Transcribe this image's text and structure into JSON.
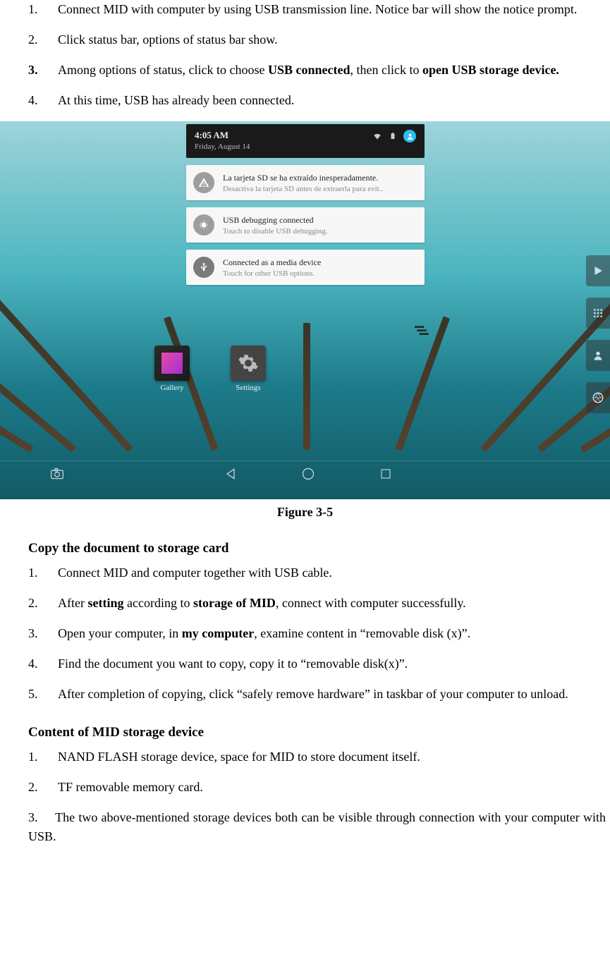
{
  "steps_usb": [
    {
      "n": "1.",
      "text": "Connect MID with computer by using USB transmission line. Notice bar will show the notice prompt.",
      "bold_n": false
    },
    {
      "n": "2.",
      "text": "Click status bar, options of status bar show.",
      "bold_n": false
    },
    {
      "n": "3.",
      "pre": "Among options of status, click to choose ",
      "b1": "USB connected",
      "mid": ", then click to ",
      "b2": "open USB storage device.",
      "bold_n": true
    },
    {
      "n": "4.",
      "text": "At this time, USB has already been connected.",
      "bold_n": false
    }
  ],
  "figure_caption": "Figure 3-5",
  "screenshot": {
    "time": "4:05 AM",
    "date": "Friday, August 14",
    "notif1": {
      "title": "La tarjeta SD se ha extraído inesperadamente.",
      "sub": "Desactiva la tarjeta SD antes de extraerla para evit.."
    },
    "notif2": {
      "title": "USB debugging connected",
      "sub": "Touch to disable USB debugging."
    },
    "notif3": {
      "title": "Connected as a media device",
      "sub": "Touch for other USB options."
    },
    "app1": "Gallery",
    "app2": "Settings"
  },
  "section2_title": "Copy the document to storage card",
  "steps_copy": [
    {
      "n": "1.",
      "text": "Connect MID and computer together with USB cable."
    },
    {
      "n": "2.",
      "pre": "After ",
      "b1": "setting",
      "mid": " according to ",
      "b2": "storage of MID",
      "post": ", connect with computer successfully."
    },
    {
      "n": "3.",
      "pre": "Open your computer, in ",
      "b1": "my computer",
      "post": ", examine content in “removable disk (x)”."
    },
    {
      "n": "4.",
      "text": "Find the document you want to copy, copy it to “removable disk(x)”."
    },
    {
      "n": "5.",
      "text": "After completion of copying, click “safely remove hardware” in taskbar of your computer to unload."
    }
  ],
  "section3_title": "Content of MID storage device",
  "steps_content": [
    {
      "n": "1.",
      "text": "NAND FLASH storage device, space for MID to store document itself."
    },
    {
      "n": "2.",
      "text": "TF removable memory card."
    }
  ],
  "final_para": {
    "n": "3.",
    "text": "The two above-mentioned storage devices both can be visible through connection with your computer with USB."
  }
}
